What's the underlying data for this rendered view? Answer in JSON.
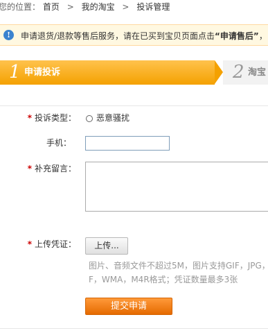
{
  "breadcrumb": {
    "prefix": "您的位置：",
    "items": [
      "首页",
      "我的淘宝",
      "投诉管理"
    ],
    "separator": ">"
  },
  "notice": {
    "icon": "info-icon",
    "text_before": "申请退货/退款等售后服务，请在已买到宝贝页面点击",
    "emphasis": "“申请售后”",
    "text_after": "，"
  },
  "steps": [
    {
      "number": "1",
      "label": "申请投诉",
      "active": true
    },
    {
      "number": "2",
      "label": "淘宝",
      "active": false
    }
  ],
  "form": {
    "complaint_type": {
      "label": "投诉类型：",
      "required": true,
      "option": "恶意骚扰"
    },
    "phone": {
      "label": "手机：",
      "value": ""
    },
    "message": {
      "label": "补充留言：",
      "required": true,
      "value": ""
    },
    "upload": {
      "label": "上传凭证：",
      "required": true,
      "button": "上传...",
      "hint_line1": "图片、音频文件不超过5M，图片支持GIF，JPG，",
      "hint_line2": "F，WMA，M4R格式；凭证数量最多3张"
    },
    "submit": "提交申请"
  },
  "colors": {
    "accent": "#f4a100",
    "submit": "#e56a00",
    "required": "#cc0000",
    "notice_bg": "#fff8e1"
  }
}
